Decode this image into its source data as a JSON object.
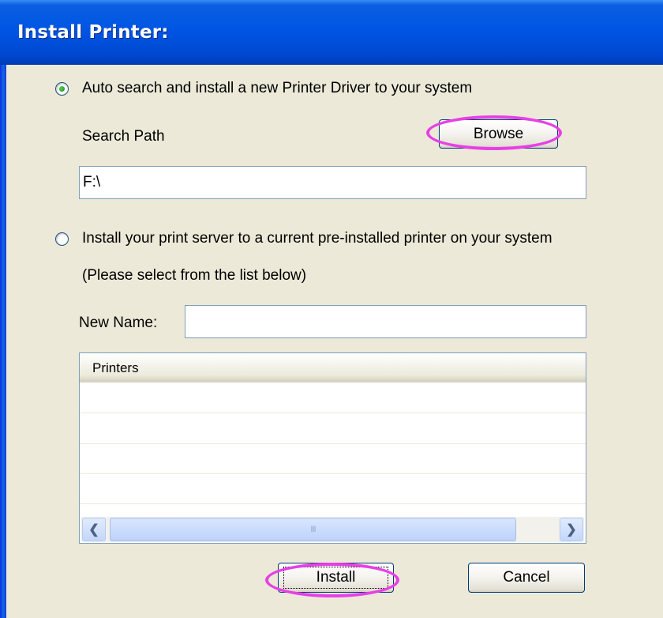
{
  "window": {
    "title": "Install Printer:"
  },
  "option_auto": {
    "label": "Auto search and install a new Printer Driver to your system",
    "selected": true,
    "search_path_label": "Search Path",
    "browse_label": "Browse",
    "search_path_value": "F:\\"
  },
  "option_existing": {
    "label": "Install your print server to a current pre-installed printer on your system",
    "sublabel": "(Please select from the list below)",
    "selected": false,
    "new_name_label": "New Name:",
    "new_name_value": ""
  },
  "printer_list": {
    "column_header": "Printers",
    "rows": [],
    "scroll_left_icon": "chevron-left-icon",
    "scroll_right_icon": "chevron-right-icon",
    "thumb_grip": "III"
  },
  "buttons": {
    "install_label": "Install",
    "cancel_label": "Cancel"
  },
  "colors": {
    "titlebar": "#0055e5",
    "dialog_bg": "#ece9d8",
    "highlight": "#e640e6"
  }
}
